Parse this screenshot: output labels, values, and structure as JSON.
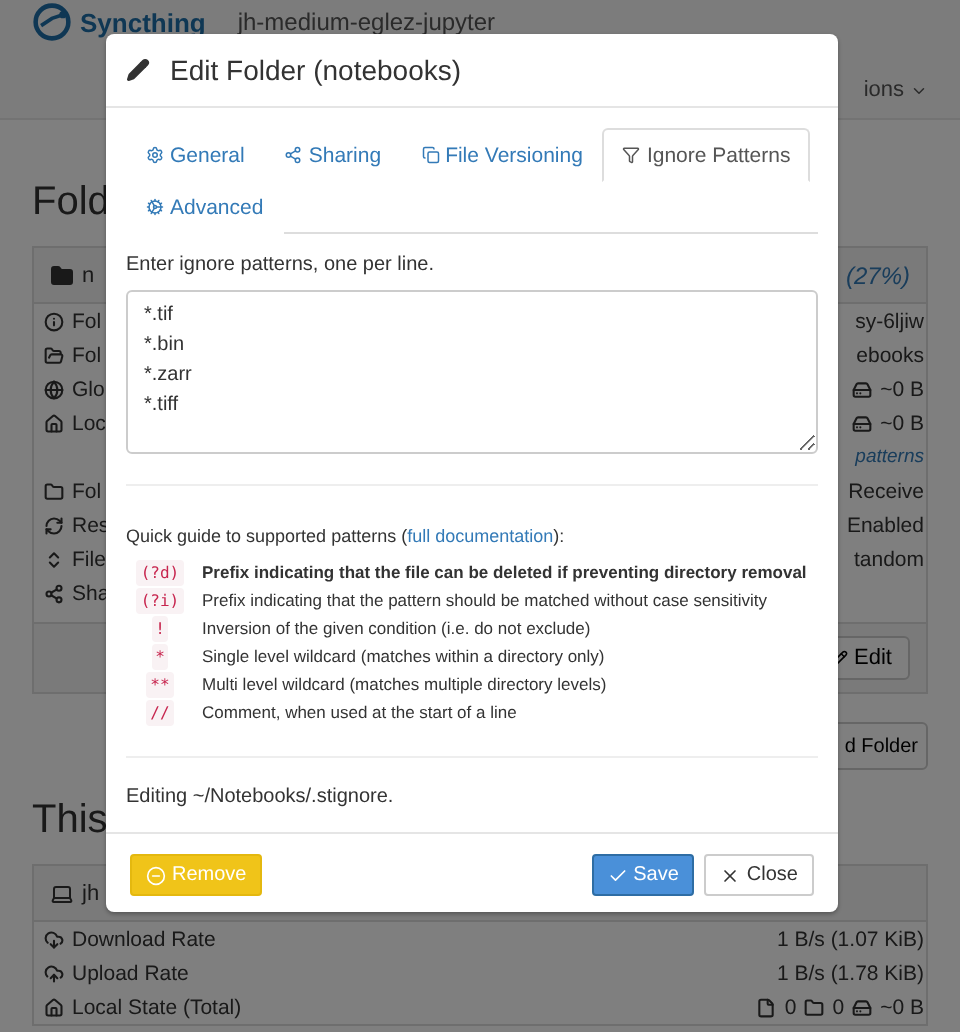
{
  "background": {
    "brand": "Syncthing",
    "device_name": "jh-medium-eglez-jupyter",
    "menu": "ions",
    "folders_heading": "Fold",
    "folder_panel": {
      "title": "n",
      "status": "(27%)",
      "rows": [
        {
          "label": "Fol",
          "value": "sy-6ljiw"
        },
        {
          "label": "Fol",
          "value": "ebooks"
        },
        {
          "label": "Glo",
          "value": "~0 B"
        },
        {
          "label": "Loc",
          "value": "~0 B"
        },
        {
          "label": "",
          "value": "patterns"
        },
        {
          "label": "Fol",
          "value": "Receive"
        },
        {
          "label": "Res",
          "value": "Enabled"
        },
        {
          "label": "File",
          "value": "tandom"
        },
        {
          "label": "Sha",
          "value": ""
        }
      ],
      "edit_button": "Edit"
    },
    "add_folder_button": "d Folder",
    "this_device_heading": "This",
    "device_panel": {
      "title": "jh",
      "rows": [
        {
          "label": "Download Rate",
          "value": "1 B/s (1.07 KiB)"
        },
        {
          "label": "Upload Rate",
          "value": "1 B/s (1.78 KiB)"
        },
        {
          "label": "Local State (Total)",
          "files": "0",
          "dirs": "0",
          "value": "~0 B"
        }
      ]
    }
  },
  "modal": {
    "title": "Edit Folder (notebooks)",
    "tabs": [
      {
        "label": "General",
        "selected": false
      },
      {
        "label": "Sharing",
        "selected": false
      },
      {
        "label": "File Versioning",
        "selected": false
      },
      {
        "label": "Ignore Patterns",
        "selected": true
      },
      {
        "label": "Advanced",
        "selected": false
      }
    ],
    "prompt": "Enter ignore patterns, one per line.",
    "patterns_value": "*.tif\n*.bin\n*.zarr\n*.tiff",
    "guide": {
      "intro": "Quick guide to supported patterns (",
      "link": "full documentation",
      "suffix": "):"
    },
    "patterns": [
      {
        "code": "(?d)",
        "text": "Prefix indicating that the file can be deleted if preventing directory removal",
        "bold": true
      },
      {
        "code": "(?i)",
        "text": "Prefix indicating that the pattern should be matched without case sensitivity",
        "bold": false
      },
      {
        "code": "!",
        "text": "Inversion of the given condition (i.e. do not exclude)",
        "bold": false
      },
      {
        "code": "*",
        "text": "Single level wildcard (matches within a directory only)",
        "bold": false
      },
      {
        "code": "**",
        "text": "Multi level wildcard (matches multiple directory levels)",
        "bold": false
      },
      {
        "code": "//",
        "text": "Comment, when used at the start of a line",
        "bold": false
      }
    ],
    "editing": "Editing ~/Notebooks/.stignore.",
    "buttons": {
      "remove": "Remove",
      "save": "Save",
      "close": "Close"
    }
  }
}
